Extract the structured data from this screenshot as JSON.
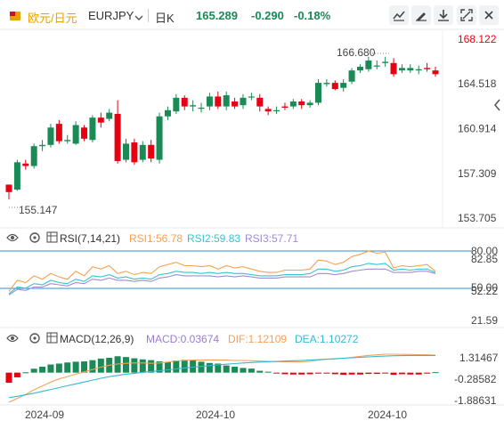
{
  "header": {
    "symbol_cn": "欧元/日元",
    "symbol": "EURJPY",
    "period": "日K",
    "last": "165.289",
    "change": "-0.290",
    "change_pct": "-0.18%"
  },
  "icons": [
    "flag-icon",
    "caret-down-icon",
    "grid-icon",
    "line-chart-icon",
    "draw-tool-icon",
    "download-icon",
    "fullscreen-icon",
    "close-icon",
    "chevron-left-icon",
    "settings-icon",
    "eye-icon"
  ],
  "colors": {
    "up": "#1a8a56",
    "down": "#e60012",
    "accent": "#e8a200",
    "text": "#333333",
    "rsi1": "#f7a152",
    "rsi2": "#35c3d0",
    "rsi3": "#a08bd8",
    "macd": "#9a7bd5",
    "dif": "#f4a05a",
    "dea": "#35b9d2",
    "hline": "#2d8fd8"
  },
  "rsi_panel": {
    "title": "RSI(7,14,21)",
    "rsi1": "RSI1:56.78",
    "rsi2": "RSI2:59.83",
    "rsi3": "RSI3:57.71",
    "ticks": [
      "80.00",
      "82.85",
      "50.00",
      "52.22",
      "21.59"
    ]
  },
  "macd_panel": {
    "title": "MACD(12,26,9)",
    "macd": "MACD:0.03674",
    "dif": "DIF:1.12109",
    "dea": "DEA:1.10272",
    "ticks": [
      "1.31467",
      "-0.28582",
      "-1.88631"
    ]
  },
  "chart_data": {
    "type": "candlestick",
    "price_axis": {
      "ticks": [
        "168.122",
        "164.518",
        "160.914",
        "157.309",
        "153.705"
      ],
      "ylim": [
        153.705,
        168.122
      ]
    },
    "x_ticks": [
      "2024-09",
      "2024-10",
      "2024-10"
    ],
    "annotations": {
      "high": "166.680",
      "low": "155.147"
    },
    "candles": [
      [
        156.4,
        155.8,
        156.3,
        155.2
      ],
      [
        156.0,
        158.2,
        158.4,
        155.9
      ],
      [
        158.1,
        157.9,
        158.4,
        157.6
      ],
      [
        157.9,
        159.5,
        159.7,
        157.7
      ],
      [
        159.5,
        159.6,
        160.0,
        159.1
      ],
      [
        159.6,
        161.0,
        161.3,
        159.4
      ],
      [
        161.3,
        159.9,
        161.6,
        159.7
      ],
      [
        159.9,
        160.0,
        160.4,
        159.7
      ],
      [
        159.7,
        161.2,
        161.5,
        159.6
      ],
      [
        161.0,
        160.1,
        161.2,
        159.9
      ],
      [
        160.0,
        161.8,
        162.0,
        159.8
      ],
      [
        161.8,
        161.4,
        162.2,
        161.0
      ],
      [
        161.7,
        162.2,
        162.5,
        161.5
      ],
      [
        162.1,
        158.3,
        163.2,
        158.1
      ],
      [
        158.4,
        159.7,
        160.1,
        158.2
      ],
      [
        159.8,
        158.2,
        160.1,
        158.0
      ],
      [
        158.4,
        159.6,
        159.9,
        158.2
      ],
      [
        159.6,
        158.5,
        160.0,
        158.2
      ],
      [
        158.4,
        161.9,
        162.2,
        158.1
      ],
      [
        161.9,
        162.4,
        162.7,
        161.6
      ],
      [
        162.3,
        163.4,
        163.7,
        162.1
      ],
      [
        163.4,
        162.7,
        163.6,
        162.4
      ],
      [
        162.7,
        162.8,
        163.2,
        162.3
      ],
      [
        162.6,
        162.6,
        163.0,
        162.2
      ],
      [
        162.7,
        163.5,
        163.8,
        162.4
      ],
      [
        163.5,
        162.7,
        163.9,
        162.5
      ],
      [
        162.7,
        163.6,
        163.9,
        162.4
      ],
      [
        163.1,
        162.7,
        163.4,
        162.5
      ],
      [
        162.8,
        163.4,
        163.7,
        162.5
      ],
      [
        163.5,
        163.5,
        163.8,
        163.2
      ],
      [
        163.4,
        162.7,
        163.7,
        162.3
      ],
      [
        162.5,
        162.3,
        162.7,
        162.0
      ],
      [
        162.4,
        162.4,
        162.7,
        162.1
      ],
      [
        162.7,
        162.6,
        163.0,
        162.4
      ],
      [
        162.7,
        163.1,
        163.3,
        162.5
      ],
      [
        163.1,
        162.8,
        163.3,
        162.5
      ],
      [
        162.8,
        163.0,
        163.2,
        162.6
      ],
      [
        163.0,
        164.6,
        164.9,
        162.8
      ],
      [
        164.5,
        164.6,
        164.9,
        164.3
      ],
      [
        164.6,
        164.1,
        164.8,
        164.0
      ],
      [
        164.2,
        164.6,
        164.9,
        163.9
      ],
      [
        164.7,
        165.6,
        165.8,
        164.5
      ],
      [
        165.6,
        165.9,
        166.1,
        165.4
      ],
      [
        165.7,
        166.4,
        166.7,
        165.5
      ],
      [
        166.0,
        166.0,
        166.4,
        165.7
      ],
      [
        166.2,
        166.3,
        166.7,
        165.9
      ],
      [
        166.2,
        165.3,
        166.6,
        165.1
      ],
      [
        165.6,
        165.8,
        166.1,
        165.4
      ],
      [
        165.6,
        165.8,
        166.1,
        165.4
      ],
      [
        165.6,
        165.7,
        166.0,
        165.3
      ],
      [
        165.8,
        165.7,
        166.2,
        165.5
      ],
      [
        165.6,
        165.3,
        165.9,
        165.1
      ]
    ],
    "rsi_lines": {
      "rsi1": [
        44,
        54,
        52,
        58,
        55,
        60,
        57,
        55,
        62,
        58,
        66,
        64,
        67,
        60,
        62,
        59,
        61,
        60,
        66,
        68,
        70,
        67,
        67,
        66,
        67,
        64,
        67,
        65,
        66,
        64,
        62,
        61,
        61,
        63,
        63,
        63,
        64,
        72,
        71,
        68,
        70,
        75,
        77,
        80,
        78,
        79,
        65,
        67,
        66,
        67,
        68,
        62
      ],
      "rsi2": [
        42,
        48,
        47,
        51,
        50,
        54,
        52,
        51,
        55,
        53,
        58,
        57,
        59,
        56,
        57,
        55,
        56,
        55,
        59,
        60,
        62,
        61,
        61,
        60,
        61,
        60,
        61,
        60,
        60,
        59,
        58,
        58,
        58,
        59,
        59,
        59,
        60,
        64,
        64,
        62,
        63,
        66,
        67,
        69,
        68,
        69,
        63,
        64,
        63,
        64,
        64,
        61
      ],
      "rsi3": [
        41,
        46,
        45,
        48,
        48,
        51,
        50,
        49,
        52,
        51,
        55,
        54,
        56,
        54,
        54,
        53,
        54,
        53,
        56,
        57,
        59,
        58,
        58,
        58,
        58,
        57,
        58,
        57,
        58,
        57,
        56,
        56,
        56,
        57,
        57,
        57,
        57,
        60,
        60,
        59,
        60,
        62,
        63,
        64,
        64,
        64,
        61,
        61,
        61,
        62,
        62,
        60
      ]
    },
    "macd_lines": {
      "hist": [
        -0.65,
        -0.3,
        0.02,
        0.25,
        0.38,
        0.52,
        0.58,
        0.65,
        0.7,
        0.72,
        0.8,
        0.9,
        0.95,
        1.05,
        1.0,
        0.92,
        0.85,
        0.8,
        0.72,
        0.68,
        0.78,
        0.82,
        0.78,
        0.7,
        0.62,
        0.58,
        0.46,
        0.38,
        0.3,
        0.26,
        0.12,
        0.06,
        -0.04,
        -0.1,
        -0.12,
        -0.12,
        -0.1,
        -0.06,
        -0.04,
        -0.1,
        -0.14,
        -0.12,
        -0.12,
        -0.08,
        -0.08,
        -0.04,
        -0.14,
        -0.1,
        -0.12,
        -0.12,
        -0.06,
        0.03
      ],
      "dif": [
        -1.9,
        -1.65,
        -1.4,
        -1.1,
        -0.85,
        -0.6,
        -0.4,
        -0.25,
        -0.1,
        0.05,
        0.2,
        0.35,
        0.48,
        0.55,
        0.6,
        0.62,
        0.62,
        0.6,
        0.62,
        0.68,
        0.75,
        0.78,
        0.8,
        0.8,
        0.82,
        0.8,
        0.8,
        0.78,
        0.78,
        0.76,
        0.74,
        0.72,
        0.7,
        0.7,
        0.7,
        0.7,
        0.72,
        0.8,
        0.86,
        0.88,
        0.92,
        0.98,
        1.04,
        1.1,
        1.14,
        1.18,
        1.18,
        1.17,
        1.16,
        1.15,
        1.14,
        1.12
      ],
      "dea": [
        -1.6,
        -1.52,
        -1.42,
        -1.32,
        -1.2,
        -1.08,
        -0.96,
        -0.84,
        -0.72,
        -0.6,
        -0.48,
        -0.36,
        -0.26,
        -0.18,
        -0.1,
        -0.04,
        0.02,
        0.07,
        0.12,
        0.18,
        0.24,
        0.3,
        0.35,
        0.4,
        0.45,
        0.5,
        0.54,
        0.58,
        0.62,
        0.65,
        0.68,
        0.7,
        0.72,
        0.74,
        0.76,
        0.78,
        0.8,
        0.83,
        0.86,
        0.89,
        0.92,
        0.95,
        0.98,
        1.01,
        1.04,
        1.06,
        1.08,
        1.09,
        1.1,
        1.1,
        1.1,
        1.1
      ]
    }
  }
}
